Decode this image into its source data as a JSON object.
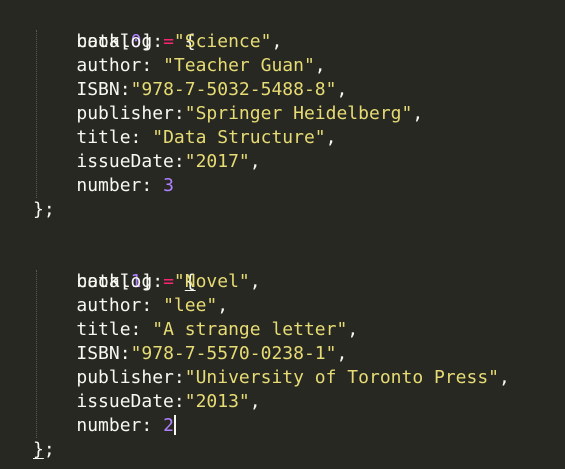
{
  "code": {
    "book0": {
      "var": "book",
      "index": "0",
      "eq": "=",
      "open": "{",
      "close": "};",
      "fields": [
        {
          "key": "catalog",
          "sep": ": ",
          "value": "\"Science\"",
          "end": ","
        },
        {
          "key": "author",
          "sep": ": ",
          "value": "\"Teacher Guan\"",
          "end": ","
        },
        {
          "key": "ISBN",
          "sep": ":",
          "value": "\"978-7-5032-5488-8\"",
          "end": ","
        },
        {
          "key": "publisher",
          "sep": ":",
          "value": "\"Springer Heidelberg\"",
          "end": ","
        },
        {
          "key": "title",
          "sep": ": ",
          "value": "\"Data Structure\"",
          "end": ","
        },
        {
          "key": "issueDate",
          "sep": ":",
          "value": "\"2017\"",
          "end": ","
        },
        {
          "key": "number",
          "sep": ": ",
          "value": "3",
          "end": ""
        }
      ]
    },
    "book1": {
      "var": "book",
      "index": "1",
      "eq": "=",
      "open": "{",
      "close_brace": "}",
      "close_semi": ";",
      "fields": [
        {
          "key": "catalog",
          "sep": ": ",
          "value": "\"Novel\"",
          "end": ","
        },
        {
          "key": "author",
          "sep": ": ",
          "value": "\"lee\"",
          "end": ","
        },
        {
          "key": "title",
          "sep": ": ",
          "value": "\"A strange letter\"",
          "end": ","
        },
        {
          "key": "ISBN",
          "sep": ":",
          "value": "\"978-7-5570-0238-1\"",
          "end": ","
        },
        {
          "key": "publisher",
          "sep": ":",
          "value": "\"University of Toronto Press\"",
          "end": ","
        },
        {
          "key": "issueDate",
          "sep": ":",
          "value": "\"2013\"",
          "end": ","
        },
        {
          "key": "number",
          "sep": ": ",
          "value": "2",
          "end": ""
        }
      ]
    }
  },
  "colors": {
    "background": "#272822",
    "text": "#f8f8f2",
    "operator": "#f92672",
    "number": "#ae81ff",
    "string": "#e6db74"
  }
}
